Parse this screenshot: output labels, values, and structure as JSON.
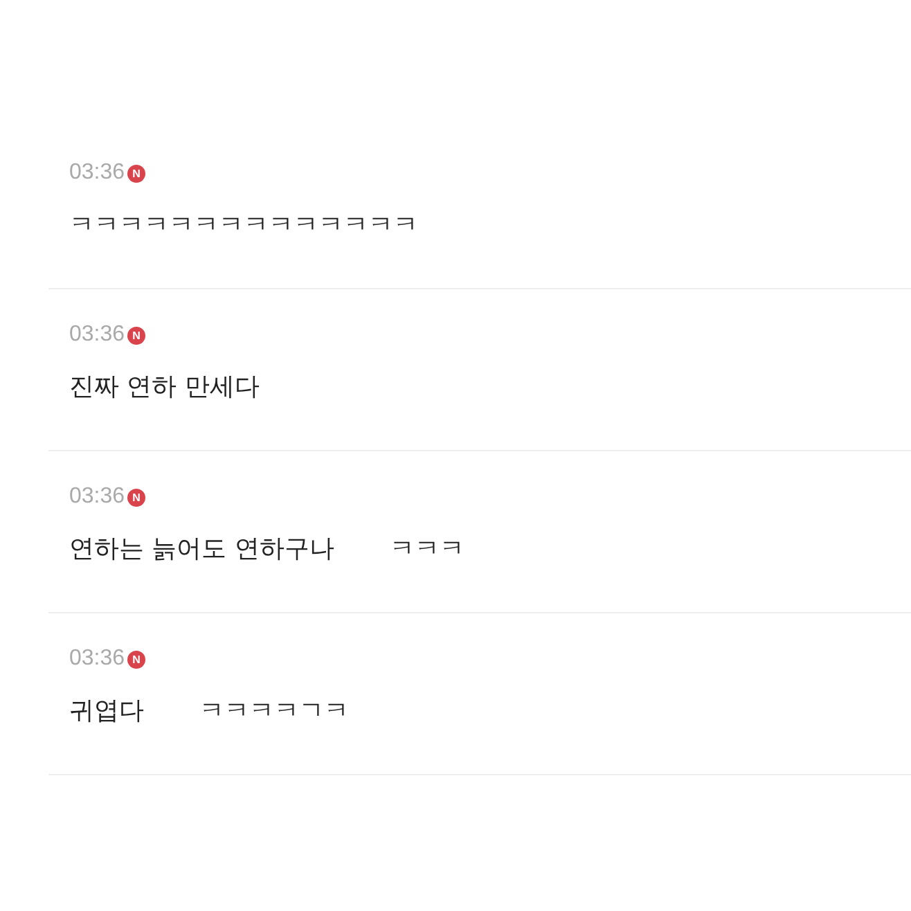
{
  "comments": [
    {
      "time": "03:36",
      "badge": "N",
      "parts": [
        "ㅋㅋㅋㅋㅋㅋㅋㅋㅋㅋㅋㅋㅋㅋ"
      ]
    },
    {
      "time": "03:36",
      "badge": "N",
      "parts": [
        "진짜 연하 만세다"
      ]
    },
    {
      "time": "03:36",
      "badge": "N",
      "parts": [
        "연하는 늙어도 연하구나",
        "ㅋㅋㅋ"
      ]
    },
    {
      "time": "03:36",
      "badge": "N",
      "parts": [
        "귀엽다",
        "ㅋㅋㅋㅋㄱㅋ"
      ]
    }
  ]
}
